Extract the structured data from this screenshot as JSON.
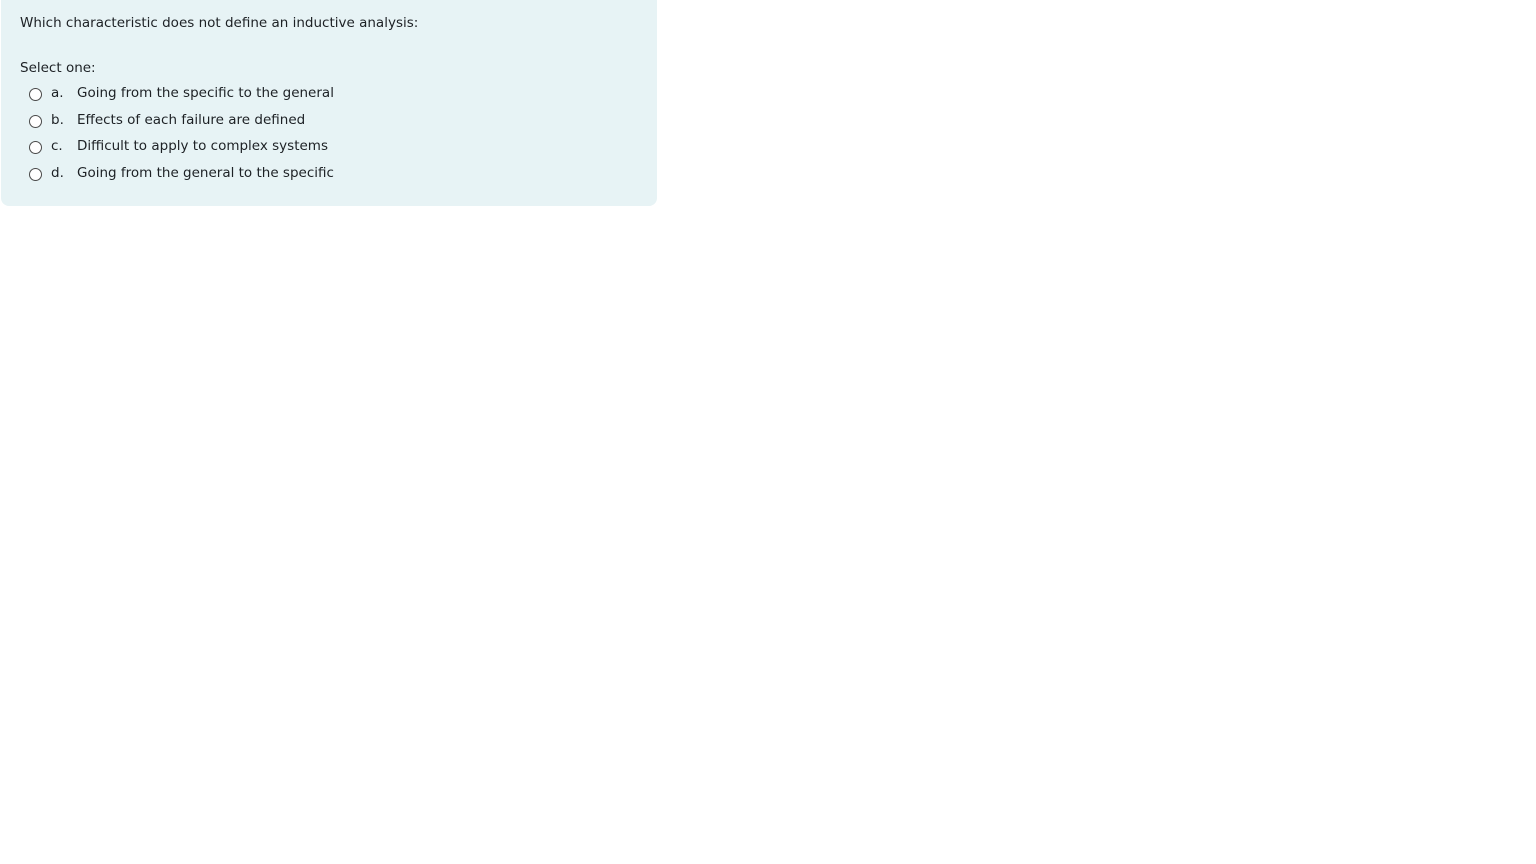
{
  "question": {
    "text": "Which characteristic does not define an inductive analysis:",
    "prompt": "Select one:",
    "answers": [
      {
        "letter": "a.",
        "label": "Going from the specific to the general"
      },
      {
        "letter": "b.",
        "label": "Effects of each failure are defined"
      },
      {
        "letter": "c.",
        "label": "Difficult to apply to complex systems"
      },
      {
        "letter": "d.",
        "label": "Going from the general to the specific"
      }
    ]
  },
  "colors": {
    "card_background": "#e7f3f5",
    "text": "#1d2125"
  }
}
